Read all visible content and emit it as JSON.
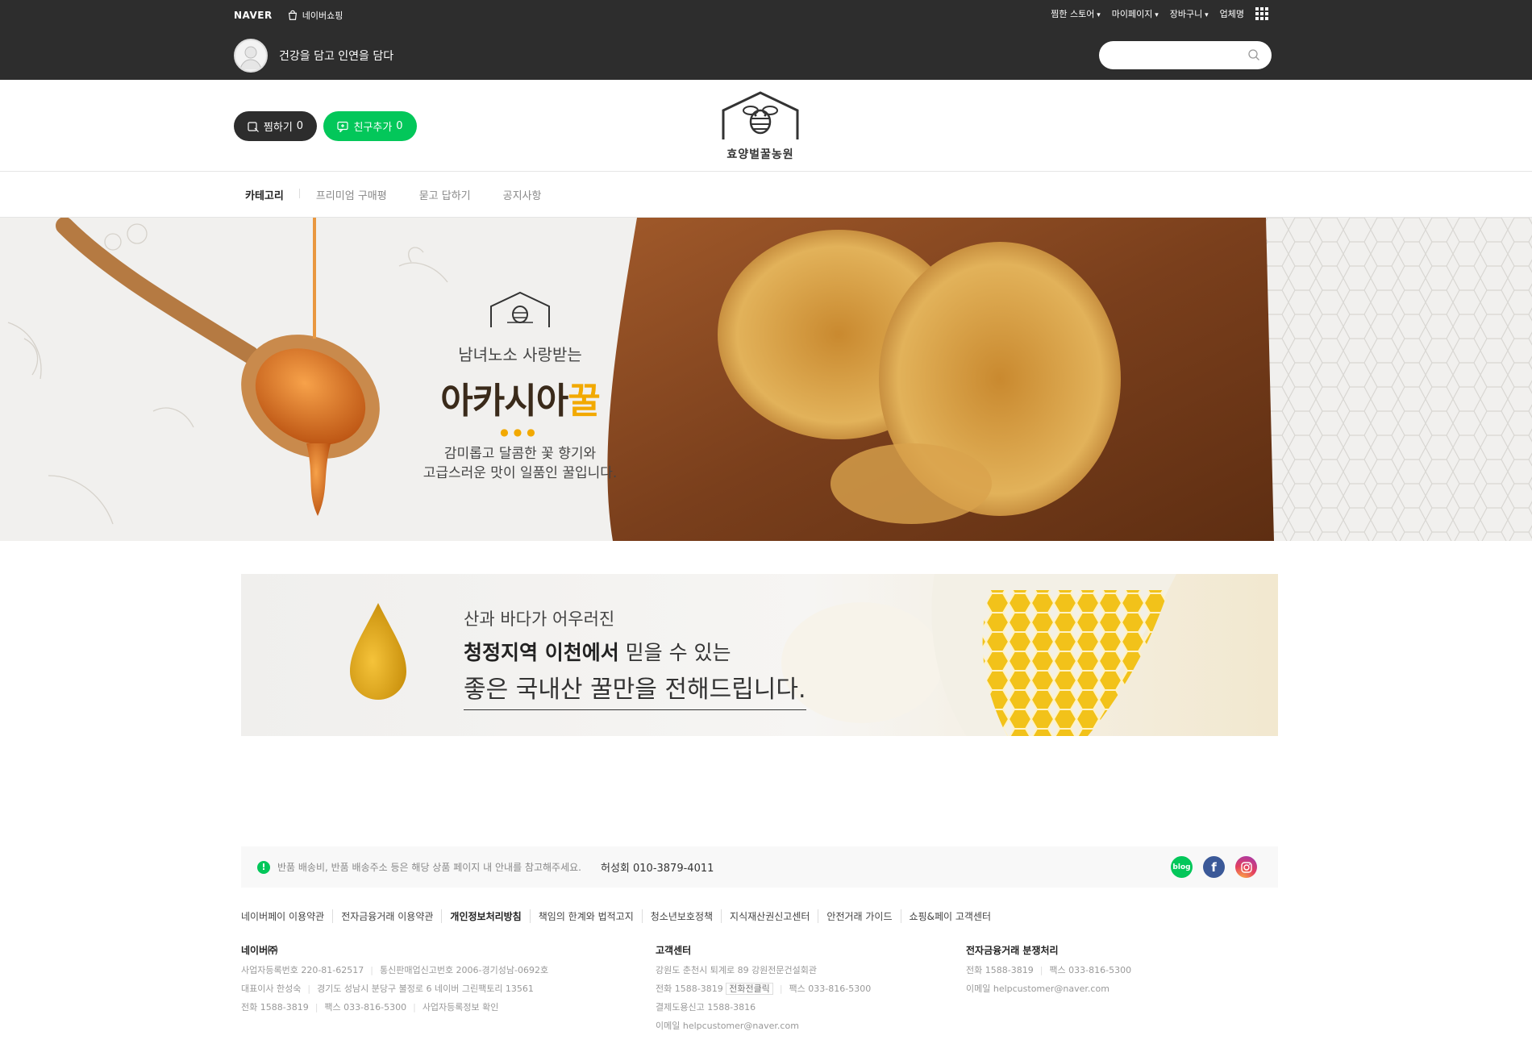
{
  "topbar": {
    "naver_logo": "NAVER",
    "naver_shopping": "네이버쇼핑",
    "menu": [
      "찜한 스토어",
      "마이페이지",
      "장바구니",
      "업체명"
    ],
    "store_name": "건강을 담고 인연을 담다",
    "search_placeholder": ""
  },
  "header": {
    "like_button": "찜하기",
    "like_count": "0",
    "friend_button": "친구추가",
    "friend_count": "0",
    "logo_text": "효양벌꿀농원"
  },
  "nav": {
    "items": [
      "카테고리",
      "프리미엄 구매평",
      "묻고 답하기",
      "공지사항"
    ]
  },
  "hero": {
    "subtitle": "남녀노소 사랑받는",
    "title_main": "아카시아",
    "title_accent": "꿀",
    "desc_line1": "감미롭고 달콤한 꽃 향기와",
    "desc_line2": "고급스러운 맛이 일품인 꿀입니다."
  },
  "banner2": {
    "line1": "산과 바다가 어우러진",
    "line2_bold": "청정지역 이천에서",
    "line2_rest": " 믿을 수 있는",
    "line3": "좋은 국내산 꿀만을 전해드립니다."
  },
  "footer": {
    "notice_icon": "!",
    "notice": "반품 배송비, 반품 배송주소 등은 해당 상품 페이지 내 안내를 참고해주세요.",
    "seller_name": "허성회",
    "seller_phone": "010-3879-4011",
    "social": {
      "blog": "blog",
      "facebook": "f"
    },
    "links": [
      "네이버페이 이용약관",
      "전자금융거래 이용약관",
      "개인정보처리방침",
      "책임의 한계와 법적고지",
      "청소년보호정책",
      "지식재산권신고센터",
      "안전거래 가이드",
      "쇼핑&페이 고객센터"
    ],
    "naver": {
      "title": "네이버㈜",
      "biz_no": "사업자등록번호 220-81-62517",
      "mail_order": "통신판매업신고번호 2006-경기성남-0692호",
      "ceo": "대표이사 한성숙",
      "address": "경기도 성남시 분당구 불정로 6 네이버 그린팩토리 13561",
      "phone": "전화 1588-3819",
      "fax": "팩스 033-816-5300",
      "biz_check": "사업자등록정보 확인"
    },
    "cs": {
      "title": "고객센터",
      "address": "강원도 춘천시 퇴계로 89 강원전문건설회관",
      "phone": "전화 1588-3819",
      "phone_btn": "전화전클릭",
      "fax": "팩스 033-816-5300",
      "dispute": "결제도용신고 1588-3816",
      "email": "이메일 helpcustomer@naver.com"
    },
    "efin": {
      "title": "전자금융거래 분쟁처리",
      "phone": "전화 1588-3819",
      "fax": "팩스 033-816-5300",
      "email": "이메일 helpcustomer@naver.com"
    }
  },
  "colors": {
    "topbar": "#2d2d2d",
    "accent_green": "#03c75a",
    "honey": "#f2a900"
  }
}
